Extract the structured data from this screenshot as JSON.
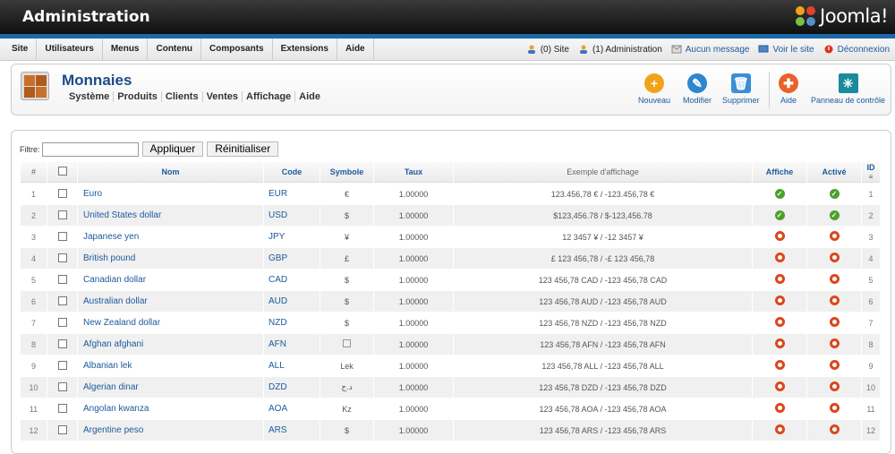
{
  "header": {
    "title": "Administration",
    "logo_text": "Joomla!"
  },
  "menu": [
    "Site",
    "Utilisateurs",
    "Menus",
    "Contenu",
    "Composants",
    "Extensions",
    "Aide"
  ],
  "status": {
    "site": "(0) Site",
    "admin": "(1) Administration",
    "messages": "Aucun message",
    "view_site": "Voir le site",
    "logout": "Déconnexion"
  },
  "page": {
    "title": "Monnaies"
  },
  "submenu": [
    "Système",
    "Produits",
    "Clients",
    "Ventes",
    "Affichage",
    "Aide"
  ],
  "toolbar": {
    "new": "Nouveau",
    "edit": "Modifier",
    "delete": "Supprimer",
    "help": "Aide",
    "control_panel": "Panneau de contrôle"
  },
  "filter": {
    "label": "Filtre:",
    "value": "",
    "apply": "Appliquer",
    "reset": "Réinitialiser"
  },
  "table": {
    "headers": {
      "num": "#",
      "name": "Nom",
      "code": "Code",
      "symbol": "Symbole",
      "rate": "Taux",
      "example": "Exemple d'affichage",
      "display": "Affiche",
      "active": "Activé",
      "id": "ID"
    },
    "rows": [
      {
        "n": "1",
        "name": "Euro",
        "code": "EUR",
        "symbol": "€",
        "rate": "1.00000",
        "example": "123.456,78 € / -123.456,78 €",
        "display": true,
        "active": true,
        "id": "1"
      },
      {
        "n": "2",
        "name": "United States dollar",
        "code": "USD",
        "symbol": "$",
        "rate": "1.00000",
        "example": "$123,456.78 / $-123,456.78",
        "display": true,
        "active": true,
        "id": "2"
      },
      {
        "n": "3",
        "name": "Japanese yen",
        "code": "JPY",
        "symbol": "¥",
        "rate": "1.00000",
        "example": "12 3457 ¥ / -12 3457 ¥",
        "display": false,
        "active": false,
        "id": "3"
      },
      {
        "n": "4",
        "name": "British pound",
        "code": "GBP",
        "symbol": "£",
        "rate": "1.00000",
        "example": "£ 123 456,78 / -£ 123 456,78",
        "display": false,
        "active": false,
        "id": "4"
      },
      {
        "n": "5",
        "name": "Canadian dollar",
        "code": "CAD",
        "symbol": "$",
        "rate": "1.00000",
        "example": "123 456,78 CAD / -123 456,78 CAD",
        "display": false,
        "active": false,
        "id": "5"
      },
      {
        "n": "6",
        "name": "Australian dollar",
        "code": "AUD",
        "symbol": "$",
        "rate": "1.00000",
        "example": "123 456,78 AUD / -123 456,78 AUD",
        "display": false,
        "active": false,
        "id": "6"
      },
      {
        "n": "7",
        "name": "New Zealand dollar",
        "code": "NZD",
        "symbol": "$",
        "rate": "1.00000",
        "example": "123 456,78 NZD / -123 456,78 NZD",
        "display": false,
        "active": false,
        "id": "7"
      },
      {
        "n": "8",
        "name": "Afghan afghani",
        "code": "AFN",
        "symbol": "",
        "rate": "1.00000",
        "example": "123 456,78 AFN / -123 456,78 AFN",
        "display": false,
        "active": false,
        "id": "8"
      },
      {
        "n": "9",
        "name": "Albanian lek",
        "code": "ALL",
        "symbol": "Lek",
        "rate": "1.00000",
        "example": "123 456,78 ALL / -123 456,78 ALL",
        "display": false,
        "active": false,
        "id": "9"
      },
      {
        "n": "10",
        "name": "Algerian dinar",
        "code": "DZD",
        "symbol": "د.ج",
        "rate": "1.00000",
        "example": "123 456,78 DZD / -123 456,78 DZD",
        "display": false,
        "active": false,
        "id": "10"
      },
      {
        "n": "11",
        "name": "Angolan kwanza",
        "code": "AOA",
        "symbol": "Kz",
        "rate": "1.00000",
        "example": "123 456,78 AOA / -123 456,78 AOA",
        "display": false,
        "active": false,
        "id": "11"
      },
      {
        "n": "12",
        "name": "Argentine peso",
        "code": "ARS",
        "symbol": "$",
        "rate": "1.00000",
        "example": "123 456,78 ARS / -123 456,78 ARS",
        "display": false,
        "active": false,
        "id": "12"
      }
    ]
  },
  "colors": {
    "accent": "#1c68a8",
    "link": "#1c5a9c",
    "ok": "#4aa02c",
    "off": "#d9481a"
  }
}
